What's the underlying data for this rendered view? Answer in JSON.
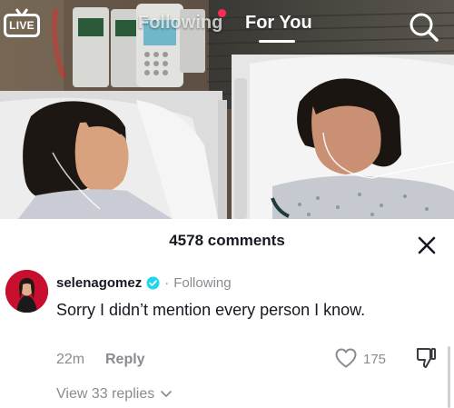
{
  "top_nav": {
    "live_label": "LIVE",
    "tabs": [
      {
        "label": "Following",
        "active": false
      },
      {
        "label": "For You",
        "active": true
      }
    ],
    "icons": {
      "live": "live-tv-icon",
      "search": "search-icon"
    }
  },
  "comments_panel": {
    "count_label": "4578 comments",
    "close_icon": "close-icon",
    "comment": {
      "username": "selenagomez",
      "verified": true,
      "separator": "·",
      "follow_status": "Following",
      "text": "Sorry I didn’t mention every person I know.",
      "time": "22m",
      "reply_label": "Reply",
      "like_count": "175",
      "view_replies_label": "View 33 replies"
    }
  },
  "colors": {
    "live_dot": "#fe2c55",
    "verified": "#20d5ec",
    "secondary_text": "#8a8b91",
    "primary_text": "#161823"
  }
}
